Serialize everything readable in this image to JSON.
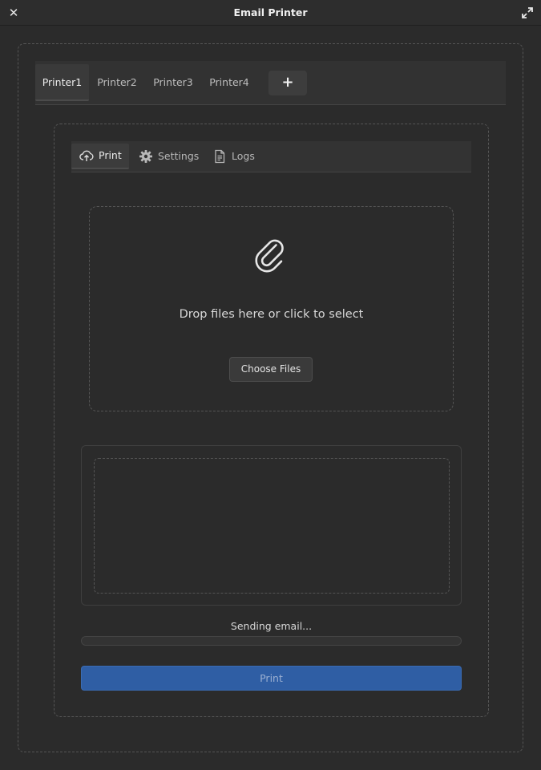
{
  "window": {
    "title": "Email Printer"
  },
  "printer_tabs": [
    {
      "label": "Printer1",
      "active": true
    },
    {
      "label": "Printer2",
      "active": false
    },
    {
      "label": "Printer3",
      "active": false
    },
    {
      "label": "Printer4",
      "active": false
    }
  ],
  "add_tab_label": "+",
  "sub_tabs": {
    "print": {
      "label": "Print",
      "icon": "upload-cloud-icon",
      "active": true
    },
    "settings": {
      "label": "Settings",
      "icon": "gear-icon",
      "active": false
    },
    "logs": {
      "label": "Logs",
      "icon": "document-icon",
      "active": false
    }
  },
  "dropzone": {
    "icon": "paperclip-icon",
    "text": "Drop files here or click to select",
    "button_label": "Choose Files"
  },
  "status": {
    "text": "Sending email...",
    "progress": 0.0
  },
  "print_button_label": "Print",
  "colors": {
    "accent": "#2f5ea4",
    "background": "#2b2b2b"
  }
}
